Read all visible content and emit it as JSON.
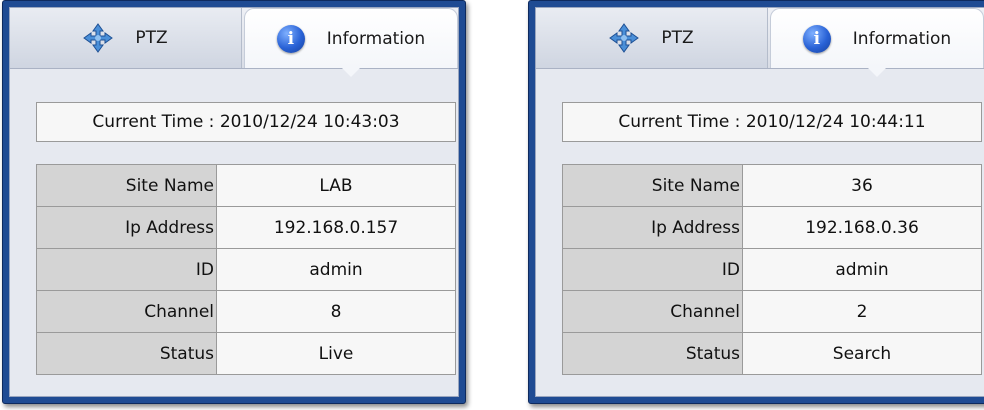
{
  "panels": [
    {
      "tabs": {
        "ptz": "PTZ",
        "info": "Information"
      },
      "current_time_label": "Current Time :",
      "current_time": "2010/12/24 10:43:03",
      "rows": [
        {
          "key": "Site Name",
          "value": "LAB"
        },
        {
          "key": "Ip Address",
          "value": "192.168.0.157"
        },
        {
          "key": "ID",
          "value": "admin"
        },
        {
          "key": "Channel",
          "value": "8"
        },
        {
          "key": "Status",
          "value": "Live"
        }
      ]
    },
    {
      "tabs": {
        "ptz": "PTZ",
        "info": "Information"
      },
      "current_time_label": "Current Time :",
      "current_time": "2010/12/24 10:44:11",
      "rows": [
        {
          "key": "Site Name",
          "value": "36"
        },
        {
          "key": "Ip Address",
          "value": "192.168.0.36"
        },
        {
          "key": "ID",
          "value": "admin"
        },
        {
          "key": "Channel",
          "value": "2"
        },
        {
          "key": "Status",
          "value": "Search"
        }
      ]
    }
  ],
  "icons": {
    "ptz": "move-arrows-icon",
    "info": "info-icon"
  },
  "colors": {
    "frame": "#1f4b93",
    "panel_bg": "#e6e9f0",
    "key_cell": "#d4d4d4",
    "value_cell": "#f7f7f7"
  }
}
